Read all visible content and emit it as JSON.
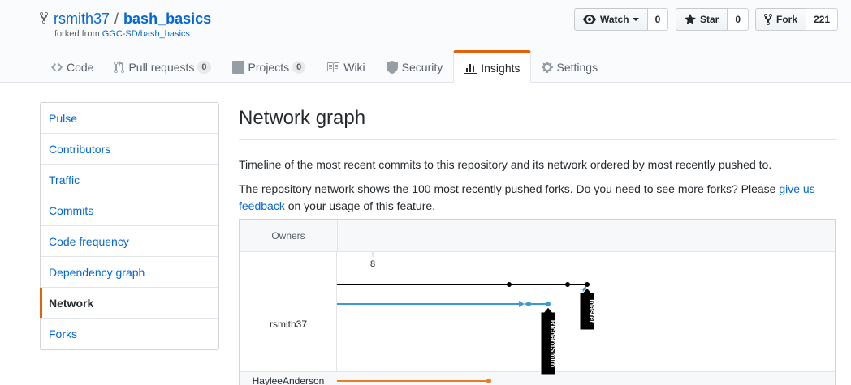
{
  "repo": {
    "owner": "rsmith37",
    "separator": "/",
    "name": "bash_basics",
    "forked_from_prefix": "forked from",
    "forked_from": "GGC-SD/bash_basics"
  },
  "actions": {
    "watch_label": "Watch",
    "watch_count": "0",
    "star_label": "Star",
    "star_count": "0",
    "fork_label": "Fork",
    "fork_count": "221"
  },
  "tabs": [
    {
      "label": "Code",
      "icon": "code-icon"
    },
    {
      "label": "Pull requests",
      "icon": "pull-request-icon",
      "counter": "0"
    },
    {
      "label": "Projects",
      "icon": "project-icon",
      "counter": "0"
    },
    {
      "label": "Wiki",
      "icon": "book-icon"
    },
    {
      "label": "Security",
      "icon": "shield-icon"
    },
    {
      "label": "Insights",
      "icon": "graph-icon",
      "selected": true
    },
    {
      "label": "Settings",
      "icon": "gear-icon"
    }
  ],
  "sidebar": {
    "items": [
      {
        "label": "Pulse"
      },
      {
        "label": "Contributors"
      },
      {
        "label": "Traffic"
      },
      {
        "label": "Commits"
      },
      {
        "label": "Code frequency"
      },
      {
        "label": "Dependency graph"
      },
      {
        "label": "Network",
        "selected": true
      },
      {
        "label": "Forks"
      }
    ]
  },
  "main": {
    "title": "Network graph",
    "desc1": "Timeline of the most recent commits to this repository and its network ordered by most recently pushed to.",
    "desc2_before": "The repository network shows the 100 most recently pushed forks. Do you need to see more forks? Please ",
    "desc2_link": "give us feedback",
    "desc2_after": " on your usage of this feature."
  },
  "network": {
    "owners_header": "Owners",
    "date_label": "8",
    "owners": [
      "rsmith37",
      "HayleeAnderson"
    ],
    "branch_labels": {
      "master": "master",
      "fork": "RichardSmith"
    },
    "colors": {
      "black": "#000000",
      "blue": "#3d9ad8",
      "orange": "#e67e22",
      "accent": "#e36209",
      "link": "#0366d6"
    }
  }
}
